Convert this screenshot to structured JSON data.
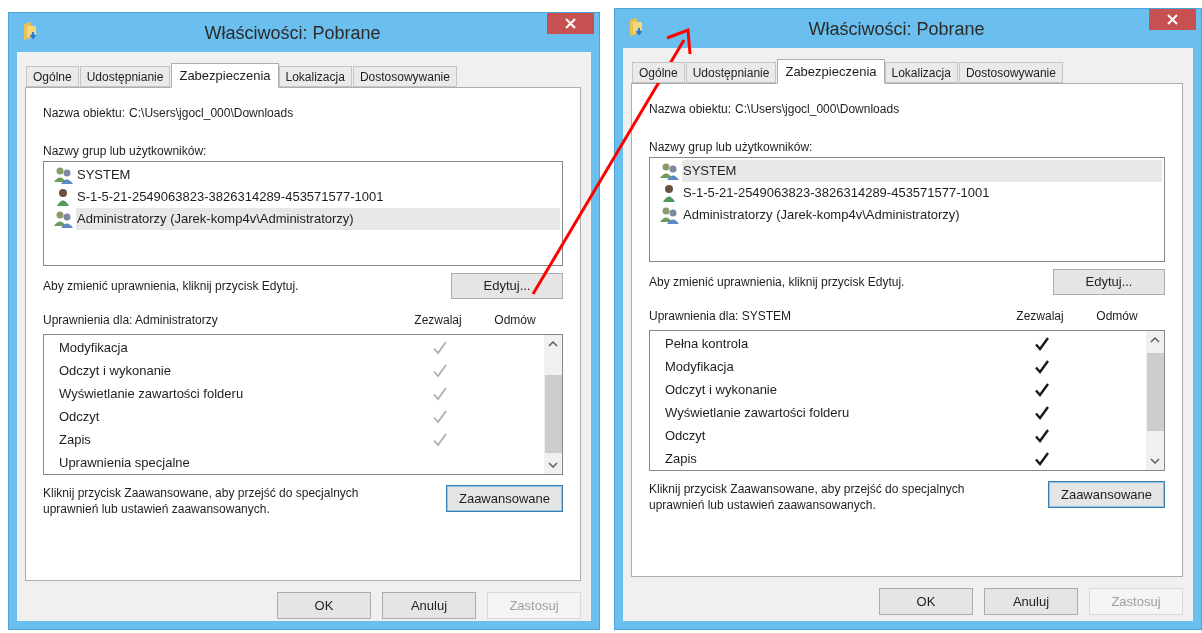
{
  "dialogs": [
    {
      "title": "Właściwości: Pobrane",
      "tabs": [
        {
          "label": "Ogólne",
          "selected": false
        },
        {
          "label": "Udostępnianie",
          "selected": false
        },
        {
          "label": "Zabezpieczenia",
          "selected": true
        },
        {
          "label": "Lokalizacja",
          "selected": false
        },
        {
          "label": "Dostosowywanie",
          "selected": false
        }
      ],
      "object_label": "Nazwa obiektu:",
      "object_path": "C:\\Users\\jgocl_000\\Downloads",
      "groups_label": "Nazwy grup lub użytkowników:",
      "users": [
        {
          "name": "SYSTEM",
          "kind": "group",
          "selected": false
        },
        {
          "name": "S-1-5-21-2549063823-3826314289-453571577-1001",
          "kind": "user",
          "selected": false
        },
        {
          "name": "Administratorzy (Jarek-komp4v\\Administratorzy)",
          "kind": "group",
          "selected": true
        }
      ],
      "edit_hint": "Aby zmienić uprawnienia, kliknij przycisk Edytuj.",
      "edit_button": "Edytuj...",
      "permissions_label": "Uprawnienia dla: Administratorzy",
      "allow_header": "Zezwalaj",
      "deny_header": "Odmów",
      "permissions": [
        {
          "name": "Modyfikacja",
          "allowed": true,
          "inherited": true
        },
        {
          "name": "Odczyt i wykonanie",
          "allowed": true,
          "inherited": true
        },
        {
          "name": "Wyświetlanie zawartości folderu",
          "allowed": true,
          "inherited": true
        },
        {
          "name": "Odczyt",
          "allowed": true,
          "inherited": true
        },
        {
          "name": "Zapis",
          "allowed": true,
          "inherited": true
        },
        {
          "name": "Uprawnienia specjalne",
          "allowed": false
        }
      ],
      "advanced_hint": "Kliknij przycisk Zaawansowane, aby przejść do specjalnych uprawnień lub ustawień zaawansowanych.",
      "advanced_button": {
        "label": "Zaawansowane",
        "focused": true
      },
      "buttons": [
        {
          "label": "OK",
          "disabled": false
        },
        {
          "label": "Anuluj",
          "disabled": false
        },
        {
          "label": "Zastosuj",
          "disabled": true
        }
      ]
    },
    {
      "title": "Właściwości: Pobrane",
      "tabs": [
        {
          "label": "Ogólne",
          "selected": false
        },
        {
          "label": "Udostępnianie",
          "selected": false
        },
        {
          "label": "Zabezpieczenia",
          "selected": true
        },
        {
          "label": "Lokalizacja",
          "selected": false
        },
        {
          "label": "Dostosowywanie",
          "selected": false
        }
      ],
      "object_label": "Nazwa obiektu:",
      "object_path": "C:\\Users\\jgocl_000\\Downloads",
      "groups_label": "Nazwy grup lub użytkowników:",
      "users": [
        {
          "name": "SYSTEM",
          "kind": "group",
          "selected": true
        },
        {
          "name": "S-1-5-21-2549063823-3826314289-453571577-1001",
          "kind": "user",
          "selected": false
        },
        {
          "name": "Administratorzy (Jarek-komp4v\\Administratorzy)",
          "kind": "group",
          "selected": false
        }
      ],
      "edit_hint": "Aby zmienić uprawnienia, kliknij przycisk Edytuj.",
      "edit_button": "Edytuj...",
      "permissions_label": "Uprawnienia dla: SYSTEM",
      "allow_header": "Zezwalaj",
      "deny_header": "Odmów",
      "permissions": [
        {
          "name": "Pełna kontrola",
          "allowed": true,
          "inherited": false
        },
        {
          "name": "Modyfikacja",
          "allowed": true,
          "inherited": false
        },
        {
          "name": "Odczyt i wykonanie",
          "allowed": true,
          "inherited": false
        },
        {
          "name": "Wyświetlanie zawartości folderu",
          "allowed": true,
          "inherited": false
        },
        {
          "name": "Odczyt",
          "allowed": true,
          "inherited": false
        },
        {
          "name": "Zapis",
          "allowed": true,
          "inherited": false
        }
      ],
      "advanced_hint": "Kliknij przycisk Zaawansowane, aby przejść do specjalnych uprawnień lub ustawień zaawansowanych.",
      "advanced_button": {
        "label": "Zaawansowane",
        "focused": true
      },
      "buttons": [
        {
          "label": "OK",
          "disabled": false
        },
        {
          "label": "Anuluj",
          "disabled": false
        },
        {
          "label": "Zastosuj",
          "disabled": true
        }
      ]
    }
  ]
}
